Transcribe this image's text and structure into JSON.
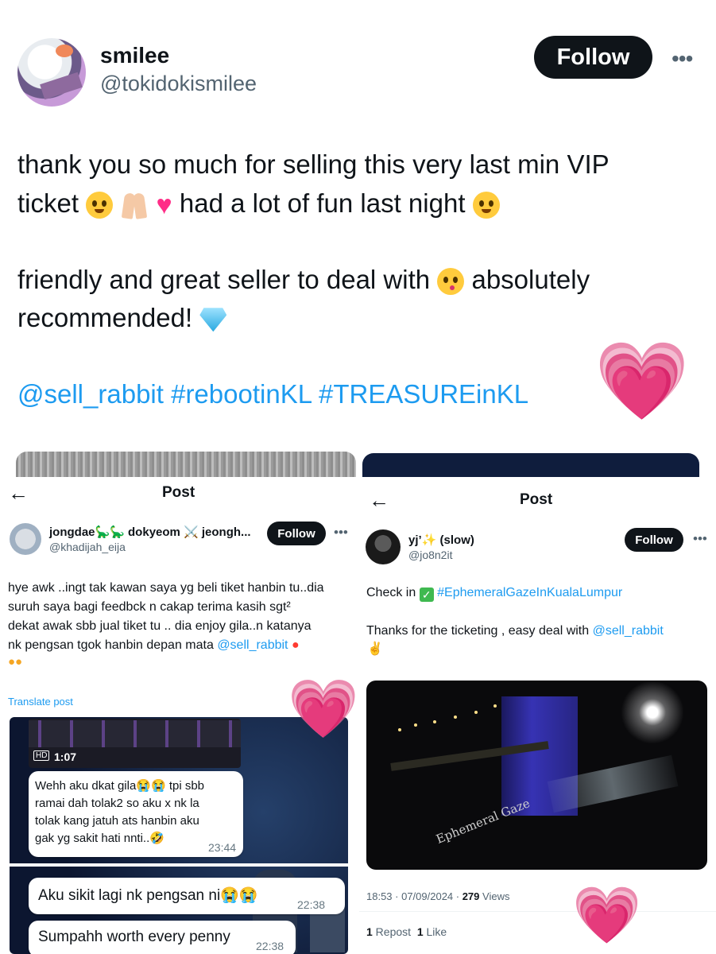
{
  "main": {
    "name": "smilee",
    "handle": "@tokidokismilee",
    "follow_label": "Follow",
    "more_label": "•••",
    "line1": "thank you so much for selling this very last min VIP",
    "line2a": "ticket",
    "line2b": "had a lot of fun last night",
    "line3a": "friendly and great seller to deal with",
    "line3b": "absolutely",
    "line4": "recommended!",
    "tags": "@sell_rabbit #rebootinKL #TREASUREinKL",
    "heart": "💗"
  },
  "left_post": {
    "back_label": "←",
    "title": "Post",
    "name": "jongdae🦕🦕 dokyeom ⚔️ jeongh...",
    "handle": "@khadijah_eija",
    "follow_label": "Follow",
    "more_label": "•••",
    "body1": "hye awk ..ingt tak kawan saya yg beli tiket hanbin tu..dia",
    "body2": "suruh saya bagi feedbck n cakap terima kasih sgt²",
    "body3": "dekat awak sbb jual tiket tu .. dia enjoy gila..n katanya",
    "body4a": "nk pengsan tgok hanbin depan mata ",
    "body4_mention": "@sell_rabbit",
    "translate_label": "Translate post",
    "video_hd": "HD",
    "video_duration": "1:07",
    "chat1_line1": "Wehh aku dkat gila😭😭 tpi sbb",
    "chat1_line2": "ramai dah tolak2 so aku x nk la",
    "chat1_line3": "tolak kang jatuh ats hanbin aku",
    "chat1_line4": "gak yg sakit hati nnti..🤣",
    "chat1_time": "23:44",
    "chat2_text": "Aku sikit lagi nk pengsan ni😭😭",
    "chat2_time": "22:38",
    "chat3_text": "Sumpahh worth every penny",
    "chat3_time": "22:38"
  },
  "right_post": {
    "back_label": "←",
    "title": "Post",
    "name": "yj’✨ (slow)",
    "handle": "@jo8n2it",
    "follow_label": "Follow",
    "more_label": "•••",
    "checkin_prefix": "Check in ",
    "checkin_tag": "#EphemeralGazeInKualaLumpur",
    "thanks_text": "Thanks for the ticketing , easy deal with ",
    "thanks_mention": "@sell_rabbit",
    "photo_sign": "Ephemeral Gaze",
    "meta_time": "18:53 · 07/09/2024 · ",
    "meta_views_count": "279",
    "meta_views_label": " Views",
    "reposts_count": "1",
    "reposts_label": " Repost",
    "likes_count": "1",
    "likes_label": " Like"
  },
  "colors": {
    "accent": "#1d9bf0",
    "follow_bg": "#0f1419",
    "heart": "#ff3c9a"
  }
}
